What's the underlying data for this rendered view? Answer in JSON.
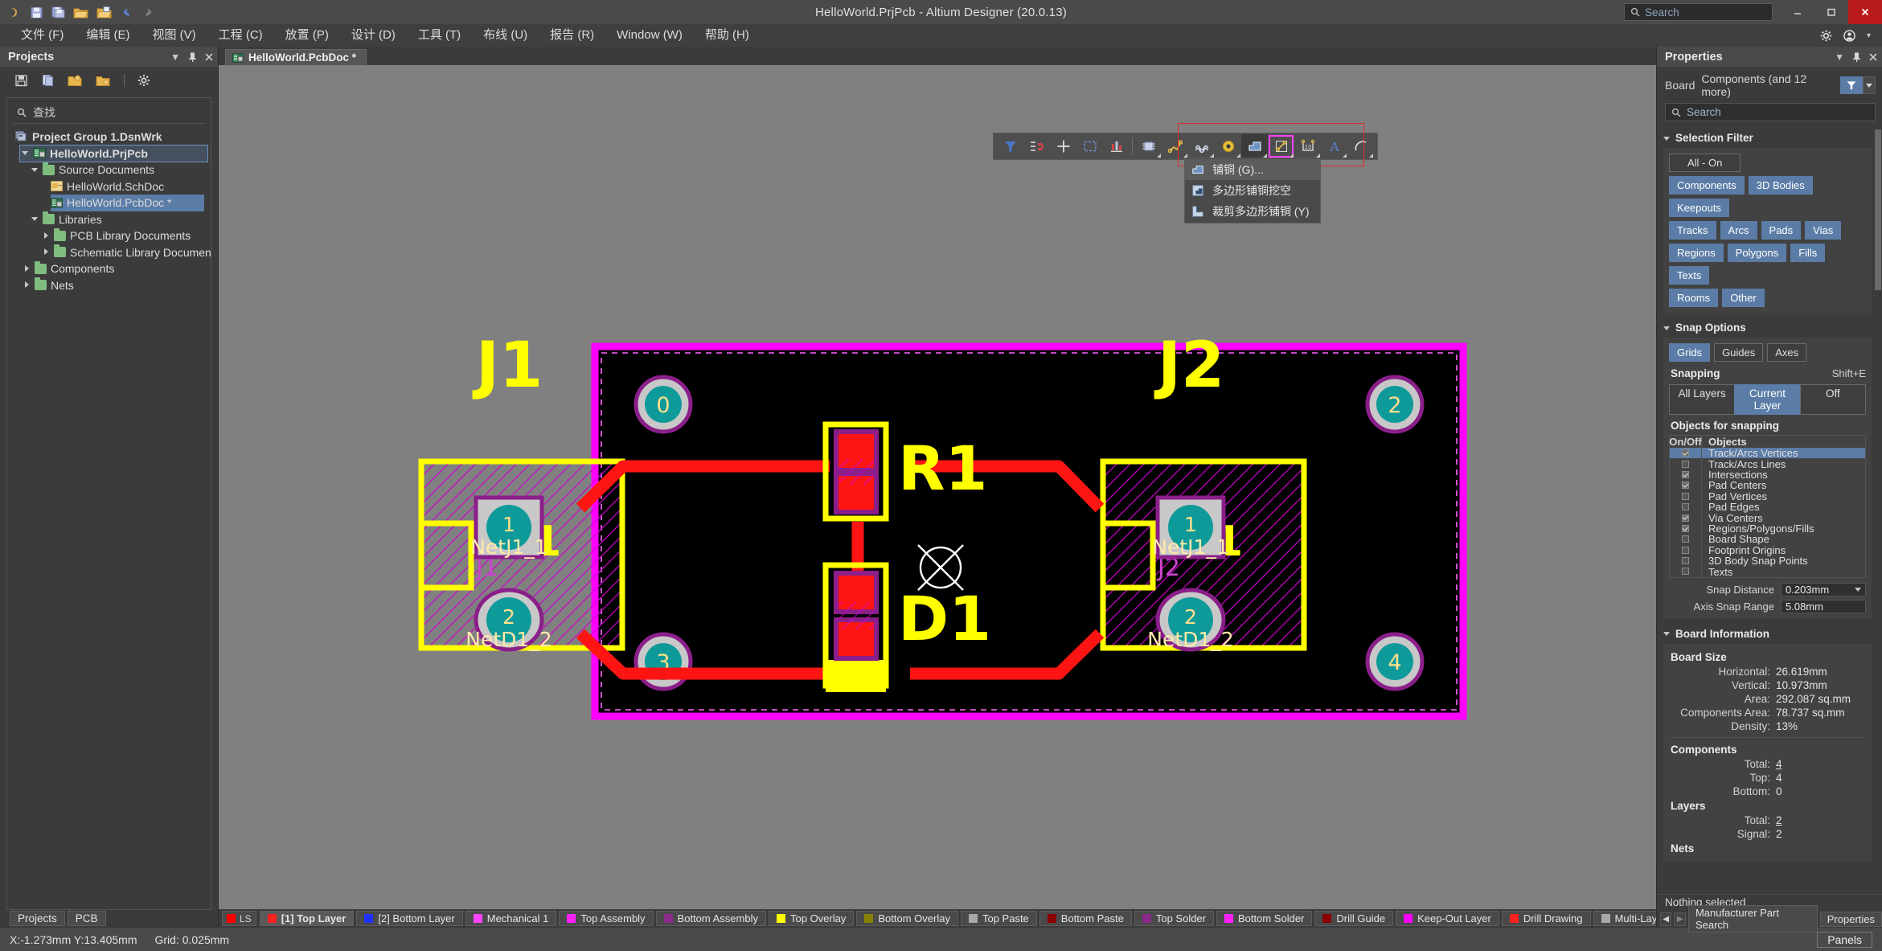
{
  "window": {
    "title": "HelloWorld.PrjPcb - Altium Designer (20.0.13)",
    "search_placeholder": "Search",
    "minimize": "–",
    "maximize": "☐",
    "close": "✕"
  },
  "menubar": {
    "items": [
      {
        "label": "文件 (F)"
      },
      {
        "label": "编辑 (E)"
      },
      {
        "label": "视图 (V)"
      },
      {
        "label": "工程 (C)"
      },
      {
        "label": "放置 (P)"
      },
      {
        "label": "设计 (D)"
      },
      {
        "label": "工具 (T)"
      },
      {
        "label": "布线 (U)"
      },
      {
        "label": "报告 (R)"
      },
      {
        "label": "Window (W)"
      },
      {
        "label": "帮助 (H)"
      }
    ]
  },
  "projects_panel": {
    "title": "Projects",
    "find_placeholder": "查找",
    "tree": [
      {
        "label": "Project Group 1.DsnWrk",
        "indent": 0,
        "arrow": "none",
        "icon": "workspace",
        "state": "normal"
      },
      {
        "label": "HelloWorld.PrjPcb",
        "indent": 1,
        "arrow": "down",
        "icon": "pcbproject",
        "state": "outlined"
      },
      {
        "label": "Source Documents",
        "indent": 2,
        "arrow": "down",
        "icon": "folder",
        "state": "normal"
      },
      {
        "label": "HelloWorld.SchDoc",
        "indent": 3,
        "arrow": "none",
        "icon": "schdoc",
        "state": "normal"
      },
      {
        "label": "HelloWorld.PcbDoc *",
        "indent": 3,
        "arrow": "none",
        "icon": "pcbdoc",
        "state": "selected"
      },
      {
        "label": "Libraries",
        "indent": 2,
        "arrow": "down",
        "icon": "folder",
        "state": "normal"
      },
      {
        "label": "PCB Library Documents",
        "indent": 3,
        "arrow": "right",
        "icon": "folder",
        "state": "normal"
      },
      {
        "label": "Schematic Library Documen",
        "indent": 3,
        "arrow": "right",
        "icon": "folder",
        "state": "normal"
      },
      {
        "label": "Components",
        "indent": 2,
        "arrow": "right",
        "icon": "folder",
        "state": "normal"
      },
      {
        "label": "Nets",
        "indent": 2,
        "arrow": "right",
        "icon": "folder",
        "state": "normal"
      }
    ],
    "bottom_tabs": [
      "Projects",
      "PCB"
    ]
  },
  "document_tab": {
    "label": "HelloWorld.PcbDoc *"
  },
  "pcb_toolbar": {
    "buttons": [
      {
        "name": "filter-icon",
        "caret": false
      },
      {
        "name": "magnet-icon",
        "caret": false
      },
      {
        "name": "crosshair-icon",
        "caret": false
      },
      {
        "name": "select-area-icon",
        "caret": false
      },
      {
        "name": "align-icon",
        "caret": false
      },
      {
        "name": "component-icon",
        "caret": true
      },
      {
        "name": "route-net-icon",
        "caret": true
      },
      {
        "name": "route-differential-icon",
        "caret": true
      },
      {
        "name": "via-icon",
        "caret": true
      },
      {
        "name": "polygon-pour-icon",
        "caret": true
      },
      {
        "name": "dimension-icon",
        "caret": true
      },
      {
        "name": "coordinate-icon",
        "caret": true
      },
      {
        "name": "text-string-icon",
        "caret": true
      },
      {
        "name": "arc-icon",
        "caret": true
      }
    ]
  },
  "dropdown_menu": {
    "items": [
      {
        "label": "铺铜 (G)...",
        "icon": "polygon-pour-icon",
        "highlighted": true
      },
      {
        "label": "多边形铺铜挖空",
        "icon": "polygon-cutout-icon",
        "highlighted": false
      },
      {
        "label": "裁剪多边形铺铜 (Y)",
        "icon": "polygon-slice-icon",
        "highlighted": false
      }
    ]
  },
  "pcb_canvas": {
    "designators": [
      "J1",
      "J2",
      "R1",
      "D1"
    ],
    "mounting_holes": [
      "0",
      "2",
      "3",
      "4"
    ],
    "pads": [
      {
        "component": "J1",
        "number": "1",
        "net": "NetJ1_1"
      },
      {
        "component": "J1",
        "number": "2",
        "net": "NetD1_2"
      },
      {
        "component": "J2",
        "number": "1",
        "net": "NetJ1_1"
      },
      {
        "component": "J2",
        "number": "2",
        "net": "NetD1_2"
      }
    ],
    "overlay_labels": [
      "J1",
      "J2"
    ],
    "pin_one_markers": [
      "1",
      "1"
    ],
    "colors": {
      "board_outline": "#ff00ff",
      "top_layer": "#ff1414",
      "top_overlay": "#ffff00",
      "pad_hole": "#00a0a0",
      "multilayer_ring": "#c8c8c8",
      "mechanical": "#cc00cc",
      "background": "#000000"
    }
  },
  "layer_tabs": {
    "ls_label": "LS",
    "ls_color": "#ff0000",
    "items": [
      {
        "label": "[1] Top Layer",
        "color": "#ff2020",
        "selected": true
      },
      {
        "label": "[2] Bottom Layer",
        "color": "#2030ff",
        "selected": false
      },
      {
        "label": "Mechanical 1",
        "color": "#ff44ff",
        "selected": false
      },
      {
        "label": "Top Assembly",
        "color": "#ff22ff",
        "selected": false
      },
      {
        "label": "Bottom Assembly",
        "color": "#8a2a8a",
        "selected": false
      },
      {
        "label": "Top Overlay",
        "color": "#ffff00",
        "selected": false
      },
      {
        "label": "Bottom Overlay",
        "color": "#888000",
        "selected": false
      },
      {
        "label": "Top Paste",
        "color": "#a8a8a8",
        "selected": false
      },
      {
        "label": "Bottom Paste",
        "color": "#8a0000",
        "selected": false
      },
      {
        "label": "Top Solder",
        "color": "#8a2a8a",
        "selected": false
      },
      {
        "label": "Bottom Solder",
        "color": "#ff22ff",
        "selected": false
      },
      {
        "label": "Drill Guide",
        "color": "#8a0000",
        "selected": false
      },
      {
        "label": "Keep-Out Layer",
        "color": "#ff00ff",
        "selected": false
      },
      {
        "label": "Drill Drawing",
        "color": "#ff2020",
        "selected": false
      },
      {
        "label": "Multi-Layer",
        "color": "#a8a8a8",
        "selected": false
      }
    ]
  },
  "properties_panel": {
    "title": "Properties",
    "object_type": "Board",
    "object_value": "Components (and 12 more)",
    "search_placeholder": "Search",
    "selection_filter": {
      "title": "Selection Filter",
      "all_on": "All - On",
      "chips": [
        {
          "label": "Components",
          "on": true
        },
        {
          "label": "3D Bodies",
          "on": true
        },
        {
          "label": "Keepouts",
          "on": true
        },
        {
          "label": "Tracks",
          "on": true
        },
        {
          "label": "Arcs",
          "on": true
        },
        {
          "label": "Pads",
          "on": true
        },
        {
          "label": "Vias",
          "on": true
        },
        {
          "label": "Regions",
          "on": true
        },
        {
          "label": "Polygons",
          "on": true
        },
        {
          "label": "Fills",
          "on": true
        },
        {
          "label": "Texts",
          "on": true
        },
        {
          "label": "Rooms",
          "on": true
        },
        {
          "label": "Other",
          "on": true
        }
      ]
    },
    "snap_options": {
      "title": "Snap Options",
      "modes": [
        {
          "label": "Grids",
          "on": true
        },
        {
          "label": "Guides",
          "on": false
        },
        {
          "label": "Axes",
          "on": false
        }
      ],
      "snapping_label": "Snapping",
      "snapping_shortcut": "Shift+E",
      "snapping_modes": [
        {
          "label": "All Layers",
          "on": false
        },
        {
          "label": "Current Layer",
          "on": true
        },
        {
          "label": "Off",
          "on": false
        }
      ],
      "objects_label": "Objects for snapping",
      "table_headers": [
        "On/Off",
        "Objects"
      ],
      "objects": [
        {
          "label": "Track/Arcs Vertices",
          "checked": true,
          "selected": true
        },
        {
          "label": "Track/Arcs Lines",
          "checked": false,
          "selected": false
        },
        {
          "label": "Intersections",
          "checked": true,
          "selected": false
        },
        {
          "label": "Pad Centers",
          "checked": true,
          "selected": false
        },
        {
          "label": "Pad Vertices",
          "checked": false,
          "selected": false
        },
        {
          "label": "Pad Edges",
          "checked": false,
          "selected": false
        },
        {
          "label": "Via Centers",
          "checked": true,
          "selected": false
        },
        {
          "label": "Regions/Polygons/Fills",
          "checked": true,
          "selected": false
        },
        {
          "label": "Board Shape",
          "checked": false,
          "selected": false
        },
        {
          "label": "Footprint Origins",
          "checked": false,
          "selected": false
        },
        {
          "label": "3D Body Snap Points",
          "checked": false,
          "selected": false
        },
        {
          "label": "Texts",
          "checked": false,
          "selected": false
        }
      ],
      "snap_distance_label": "Snap Distance",
      "snap_distance_value": "0.203mm",
      "axis_snap_label": "Axis Snap Range",
      "axis_snap_value": "5.08mm"
    },
    "board_information": {
      "title": "Board Information",
      "board_size_label": "Board Size",
      "board_size": [
        {
          "key": "Horizontal:",
          "value": "26.619mm"
        },
        {
          "key": "Vertical:",
          "value": "10.973mm"
        },
        {
          "key": "Area:",
          "value": "292.087 sq.mm"
        },
        {
          "key": "Components Area:",
          "value": "78.737 sq.mm"
        },
        {
          "key": "Density:",
          "value": "13%"
        }
      ],
      "components_label": "Components",
      "components": [
        {
          "key": "Total:",
          "value": "4",
          "link": true
        },
        {
          "key": "Top:",
          "value": "4",
          "link": false
        },
        {
          "key": "Bottom:",
          "value": "0",
          "link": false
        }
      ],
      "layers_label": "Layers",
      "layers": [
        {
          "key": "Total:",
          "value": "2",
          "link": true
        },
        {
          "key": "Signal:",
          "value": "2",
          "link": false
        }
      ],
      "nets_label": "Nets"
    },
    "status": "Nothing selected",
    "tabs": [
      "Manufacturer Part Search",
      "Properties"
    ]
  },
  "statusbar": {
    "coordinates": "X:-1.273mm Y:13.405mm",
    "grid": "Grid: 0.025mm",
    "panels_button": "Panels"
  }
}
